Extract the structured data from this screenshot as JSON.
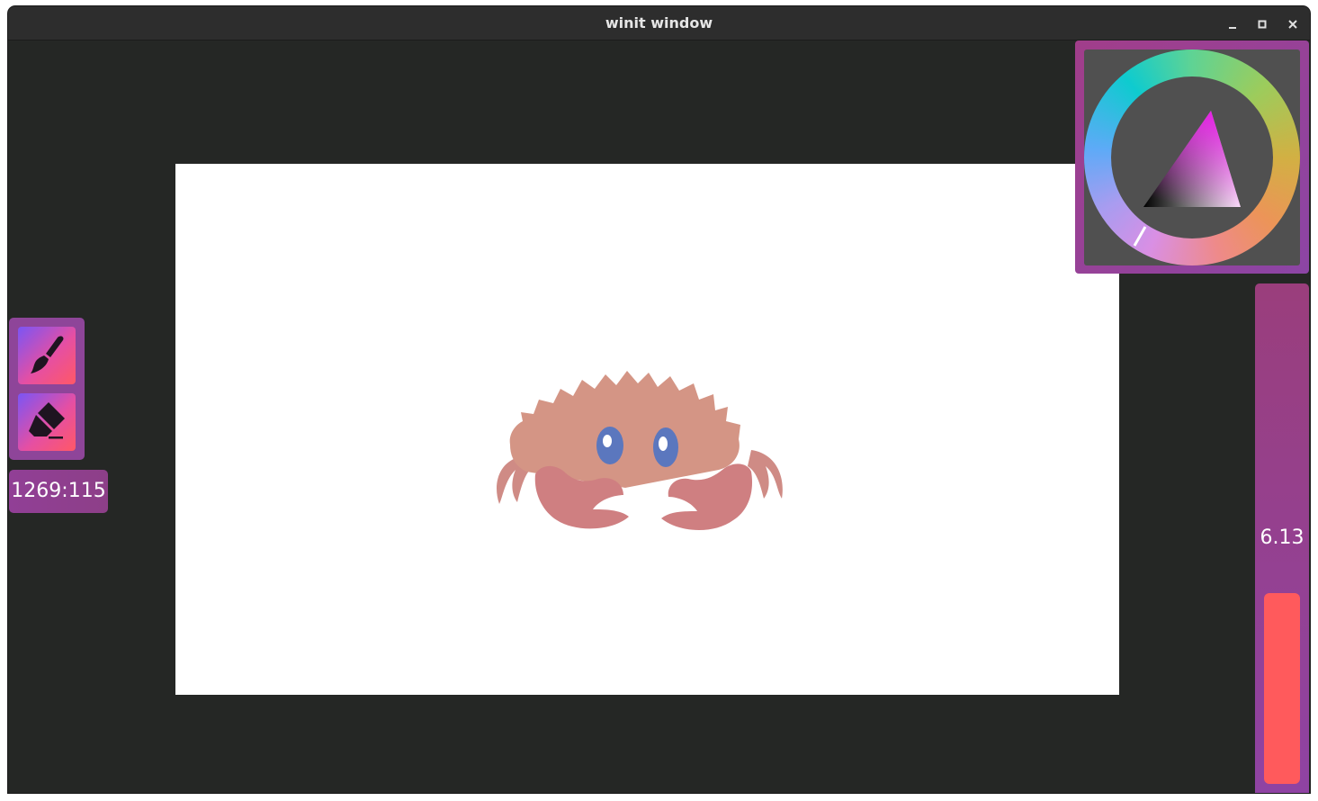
{
  "window": {
    "title": "winit window",
    "minimize_icon": "minimize-icon",
    "maximize_icon": "maximize-icon",
    "close_icon": "close-icon"
  },
  "tools": [
    {
      "name": "brush",
      "icon": "paintbrush-icon"
    },
    {
      "name": "eraser",
      "icon": "eraser-icon"
    }
  ],
  "coordinates": "1269:115",
  "brush_size": {
    "value": "6.13",
    "fill_fraction": 0.98,
    "fill_color": "#ff5a5c"
  },
  "color_picker": {
    "selected_hue_color": "#e620e6"
  },
  "canvas": {
    "background": "#ffffff",
    "drawing": "crab-mascot"
  },
  "colors": {
    "accent": "#8e4599",
    "window_bg": "#252725"
  }
}
